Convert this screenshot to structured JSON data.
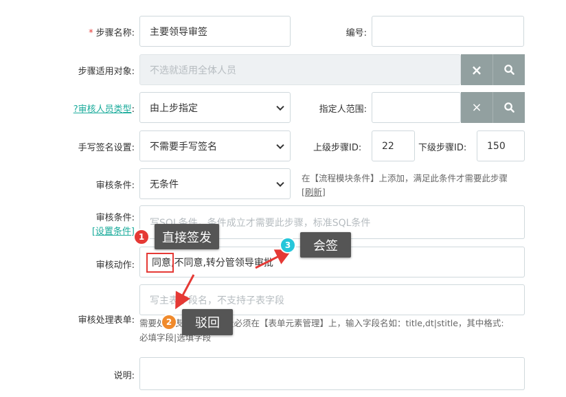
{
  "form": {
    "step_name": {
      "label": "步骤名称:",
      "required_mark": "*",
      "value": "主要领导审签"
    },
    "number": {
      "label": "编号:",
      "value": ""
    },
    "applicable": {
      "label": "步骤适用对象:",
      "placeholder": "不选就适用全体人员",
      "clear_glyph": "×",
      "search_glyph": "🔍"
    },
    "approver_type": {
      "label": "?审核人员类型",
      "colon": ":",
      "selected": "由上步指定"
    },
    "designated_range": {
      "label": "指定人范围:",
      "clear_glyph": "×",
      "search_glyph": "🔍"
    },
    "signature": {
      "label": "手写签名设置:",
      "selected": "不需要手写签名"
    },
    "prev_step": {
      "label": "上级步骤ID:",
      "value": "22"
    },
    "next_step": {
      "label": "下级步骤ID:",
      "value": "150"
    },
    "condition": {
      "label": "审核条件:",
      "selected": "无条件",
      "hint": "在【流程模块条件】上添加，满足此条件才需要此步骤",
      "refresh_link": "[刷新]"
    },
    "condition_sql": {
      "label": "审核条件:",
      "set_link": "[设置条件]",
      "placeholder": "写SQL条件，条件成立才需要此步骤，标准SQL条件"
    },
    "action": {
      "label": "审核动作:",
      "value_highlight": "同意",
      "value_rest": ",不同意,转分管领导审批"
    },
    "form_fields": {
      "label": "审核处理表单:",
      "placeholder": "写主表字段名，不支持子表字段",
      "hint_line1": "需要处理表单字段，字段必须在【表单元素管理】上，输入字段名如：title,dt|stitle，其中格式:",
      "hint_line2": "必填字段|选填字段"
    },
    "description": {
      "label": "说明:",
      "value": ""
    }
  },
  "annotations": [
    {
      "number": "1",
      "text": "直接签发",
      "color": "#e53935"
    },
    {
      "number": "2",
      "text": "驳回",
      "color": "#f08a2c"
    },
    {
      "number": "3",
      "text": "会签",
      "color": "#26c6da"
    }
  ]
}
